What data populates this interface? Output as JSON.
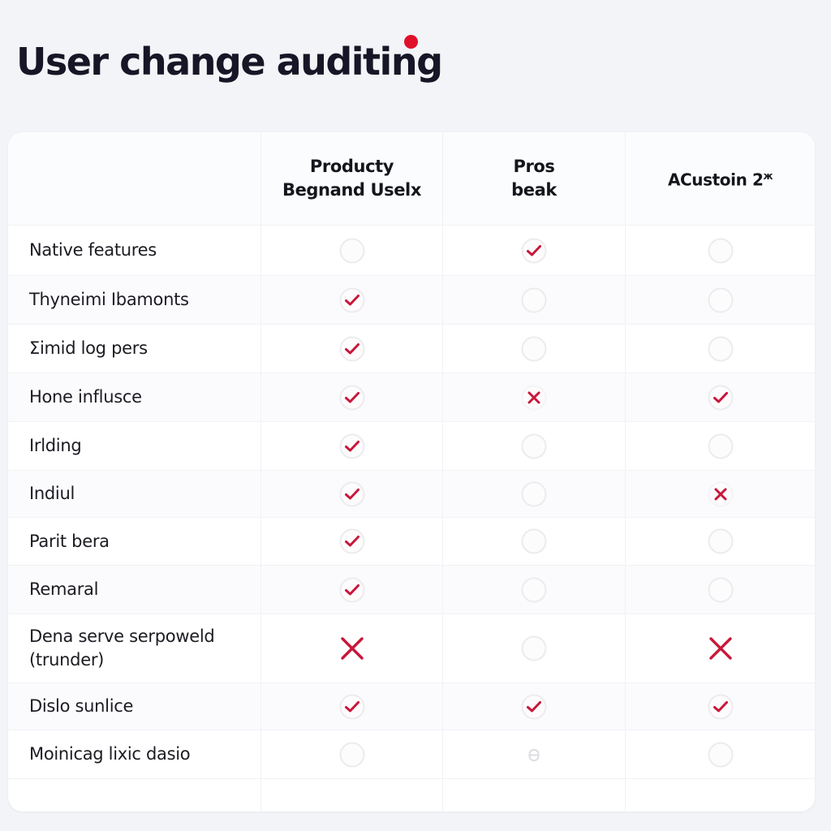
{
  "header": {
    "title": "User change auditing"
  },
  "colors": {
    "accent": "#c8173a",
    "empty_circle": "#ececef",
    "background": "#f3f4f8",
    "card": "#ffffff"
  },
  "table": {
    "columns": [
      {
        "label_line1": "Productу",
        "label_line2": "Begnand Uselx"
      },
      {
        "label_line1": "Pros",
        "label_line2": "beak"
      },
      {
        "label": "ACustoin 2",
        "sup": "ж"
      }
    ],
    "rows": [
      {
        "label": "Native features",
        "cells": [
          "empty",
          "check",
          "empty"
        ]
      },
      {
        "label": "Thyneimi Ibamonts",
        "cells": [
          "check",
          "empty",
          "empty"
        ]
      },
      {
        "label": "Σimid log pers",
        "cells": [
          "check",
          "empty",
          "empty"
        ]
      },
      {
        "label": "Hone influsce",
        "cells": [
          "check",
          "cross",
          "check"
        ]
      },
      {
        "label": "Irlding",
        "cells": [
          "check",
          "empty",
          "empty"
        ]
      },
      {
        "label": "Indiul",
        "cells": [
          "check",
          "empty",
          "cross"
        ]
      },
      {
        "label": "Parit bera",
        "cells": [
          "check",
          "empty",
          "empty"
        ]
      },
      {
        "label": "Remaral",
        "cells": [
          "check",
          "empty",
          "empty"
        ]
      },
      {
        "label": "Dena serve serpoweld",
        "label_line2": "(trunder)",
        "cells": [
          "cross-large",
          "empty",
          "cross-large"
        ]
      },
      {
        "label": "Dislo sunlice",
        "cells": [
          "check",
          "check",
          "check"
        ]
      },
      {
        "label": "Moinicag lixic dasio",
        "cells": [
          "empty",
          "lock",
          "empty"
        ]
      }
    ]
  },
  "icons": {
    "check": "checkmark-icon",
    "cross": "cross-icon",
    "cross-large": "cross-icon",
    "empty": "empty-circle-icon",
    "lock": "lock-icon"
  }
}
